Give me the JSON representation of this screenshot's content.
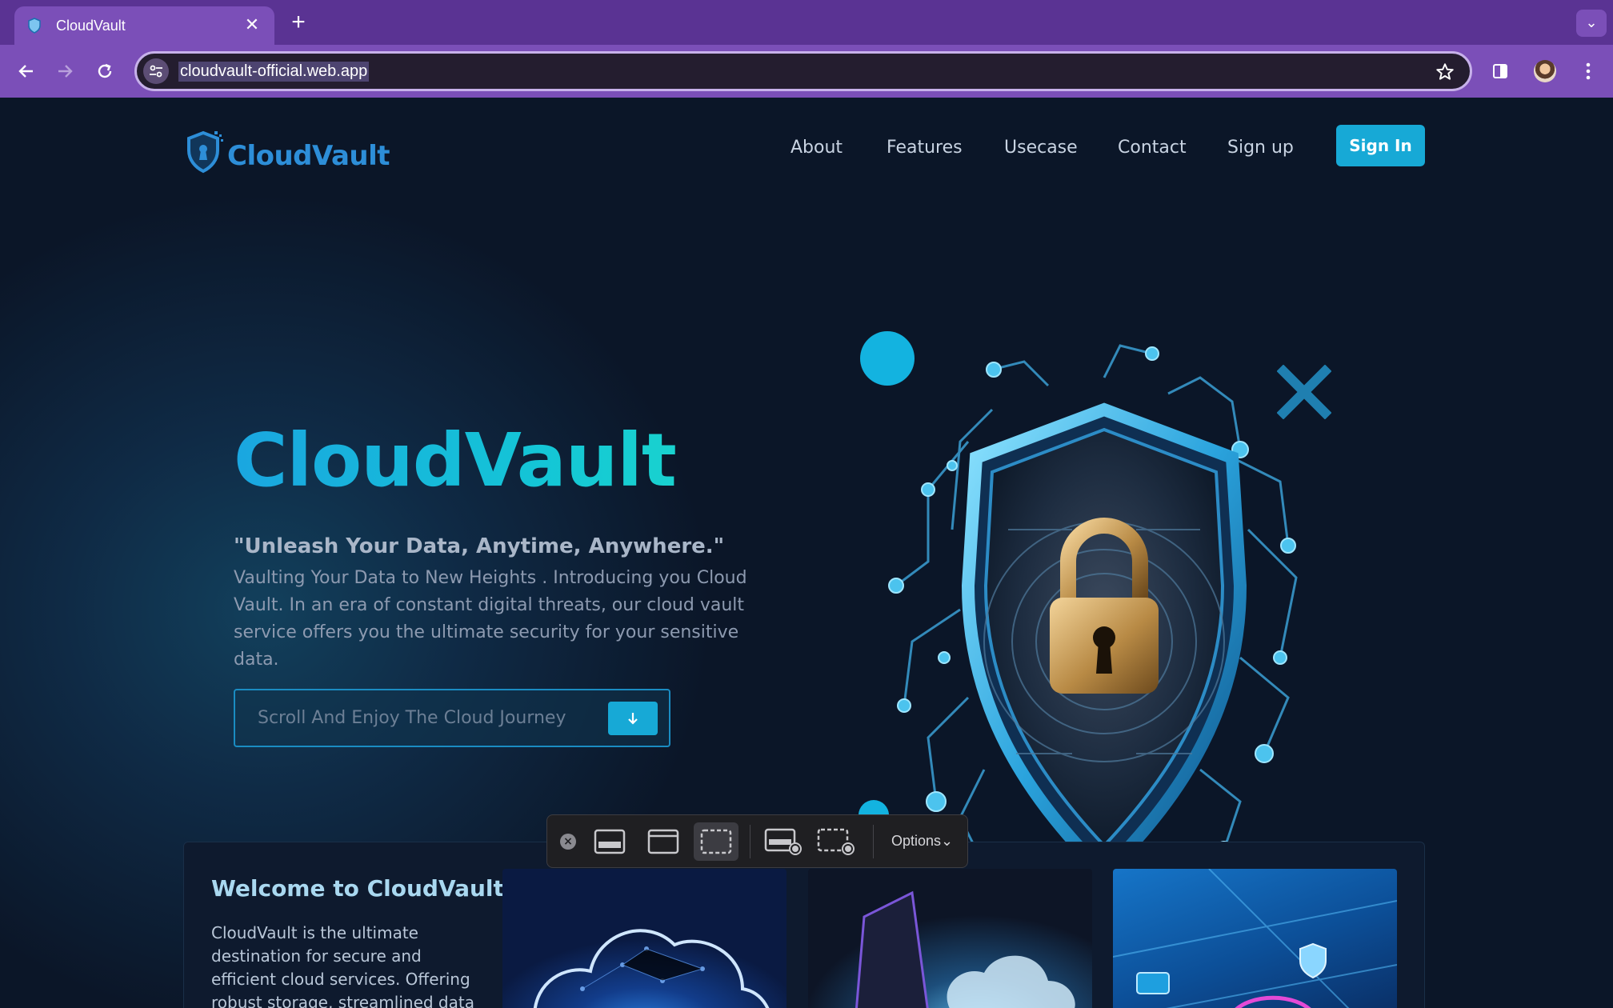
{
  "browser": {
    "tab_title": "CloudVault",
    "new_tab": "+",
    "url": "cloudvault-official.web.app"
  },
  "site": {
    "logo_text": "CloudVault",
    "nav": [
      "About",
      "Features",
      "Usecase",
      "Contact",
      "Sign up"
    ],
    "signin_label": "Sign In",
    "hero_title": "CloudVault",
    "tagline": "\"Unleash Your Data, Anytime, Anywhere.\"",
    "description": "Vaulting Your Data to New Heights . Introducing you Cloud Vault. In an era of constant digital threats, our cloud vault service offers you the ultimate security for your sensitive data.",
    "scroll_cta": "Scroll And Enjoy The Cloud Journey",
    "welcome_title": "Welcome to CloudVault",
    "welcome_text": "CloudVault is the ultimate destination for secure and efficient cloud services. Offering robust storage, streamlined data"
  },
  "capture_toolbar": {
    "options_label": "Options"
  },
  "colors": {
    "accent": "#17a9d6",
    "chrome": "#7b4fb8",
    "page_bg": "#0b1628"
  }
}
